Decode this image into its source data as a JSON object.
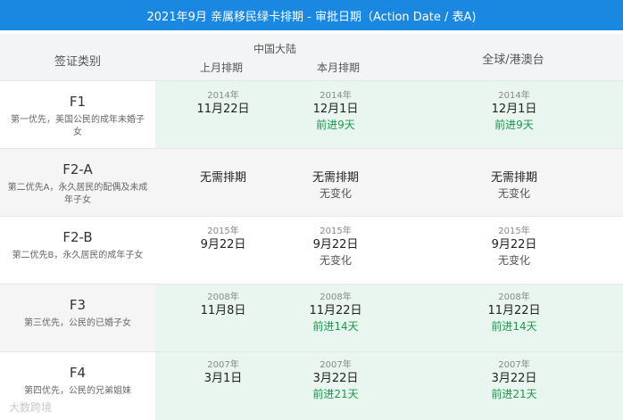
{
  "title": "2021年9月 亲属移民绿卡排期 - 审批日期（Action Date / 表A)",
  "header": {
    "category": "签证类别",
    "group": "中国大陆",
    "last_month": "上月排期",
    "this_month": "本月排期",
    "global": "全球/港澳台"
  },
  "rows": [
    {
      "code": "F1",
      "desc": "第一优先，美国公民的成年未婚子女",
      "last": {
        "year": "2014年",
        "date": "11月22日",
        "status": ""
      },
      "cn": {
        "year": "2014年",
        "date": "12月1日",
        "status": "前进9天"
      },
      "global": {
        "year": "2014年",
        "date": "12月1日",
        "status": "前进9天"
      }
    },
    {
      "code": "F2-A",
      "desc": "第二优先A，永久居民的配偶及未成年子女",
      "last": {
        "year": "",
        "date": "无需排期",
        "status": ""
      },
      "cn": {
        "year": "",
        "date": "无需排期",
        "status": "无变化"
      },
      "global": {
        "year": "",
        "date": "无需排期",
        "status": "无变化"
      }
    },
    {
      "code": "F2-B",
      "desc": "第二优先B，永久居民的成年子女",
      "last": {
        "year": "2015年",
        "date": "9月22日",
        "status": ""
      },
      "cn": {
        "year": "2015年",
        "date": "9月22日",
        "status": "无变化"
      },
      "global": {
        "year": "2015年",
        "date": "9月22日",
        "status": "无变化"
      }
    },
    {
      "code": "F3",
      "desc": "第三优先，公民的已婚子女",
      "last": {
        "year": "2008年",
        "date": "11月8日",
        "status": ""
      },
      "cn": {
        "year": "2008年",
        "date": "11月22日",
        "status": "前进14天"
      },
      "global": {
        "year": "2008年",
        "date": "11月22日",
        "status": "前进14天"
      }
    },
    {
      "code": "F4",
      "desc": "第四优先，公民的兄弟姐妹",
      "last": {
        "year": "2007年",
        "date": "3月1日",
        "status": ""
      },
      "cn": {
        "year": "2007年",
        "date": "3月22日",
        "status": "前进21天"
      },
      "global": {
        "year": "2007年",
        "date": "3月22日",
        "status": "前进21天"
      }
    }
  ],
  "watermark": "大数跨境",
  "colors": {
    "header_bar": "#1a88e0",
    "advance": "#1a9a4a",
    "highlight": "#e8f6ef"
  }
}
